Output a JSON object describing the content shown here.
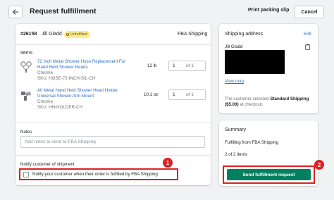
{
  "header": {
    "title": "Request fulfillment",
    "print_label": "Print packing slip",
    "cancel_label": "Cancel"
  },
  "order": {
    "number": "#26158",
    "customer": "Jill Gladd",
    "status_badge": "Unfulfilled",
    "location": "FBA Shipping"
  },
  "items_label": "Items",
  "items": [
    {
      "title_line1": "72 Inch Metal Shower Hose Replacement For",
      "title_line2": "Hand Held Shower Heads",
      "variant": "Chrome",
      "sku": "SKU: HOSE-72-INCH-SIL-CH",
      "weight": "12 lb",
      "qty": "1",
      "qty_of": "of 1"
    },
    {
      "title_line1": "All Metal Hand Held Shower Head Holder",
      "title_line2": "Universal Shower Arm Mount",
      "variant": "Chrome",
      "sku": "SKU: HH-HOLDER-CH",
      "weight": "10.1 oz",
      "qty": "1",
      "qty_of": "of 1"
    }
  ],
  "notes": {
    "label": "Notes",
    "placeholder": "Add notes to send to FBA Shipping"
  },
  "notify": {
    "heading": "Notify customer of shipment",
    "checkbox_label": "Notify your customer when their order is fulfilled by FBA Shipping",
    "callout": "1"
  },
  "shipping": {
    "heading": "Shipping address",
    "edit_label": "Edit",
    "name": "Jill Gladd",
    "view_map": "View map",
    "selected_line1_prefix": "The customer selected ",
    "selected_method": "Standard Shipping",
    "selected_price": "($5.00)",
    "selected_line2_suffix": " at checkout."
  },
  "summary": {
    "heading": "Summary",
    "line1": "Fulfilling from FBA Shipping",
    "line2": "2 of 2 items",
    "send_label": "Send fulfillment request",
    "callout": "2"
  },
  "colors": {
    "primary_button": "#008060",
    "link": "#2c6ecb",
    "callout": "#e02020",
    "badge": "#ffea8a"
  }
}
